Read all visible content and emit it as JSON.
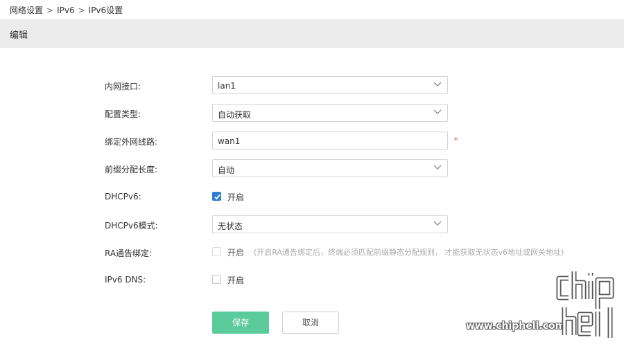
{
  "breadcrumb": {
    "items": [
      "网络设置",
      "IPv6",
      "IPv6设置"
    ],
    "separator": ">"
  },
  "section": {
    "title": "编辑"
  },
  "form": {
    "lan_interface": {
      "label": "内网接口:",
      "value": "lan1"
    },
    "config_type": {
      "label": "配置类型:",
      "value": "自动获取"
    },
    "wan_line": {
      "label": "绑定外网线路:",
      "value": "wan1",
      "required_mark": "*"
    },
    "prefix_length": {
      "label": "前缀分配长度:",
      "value": "自动"
    },
    "dhcpv6": {
      "label": "DHCPv6:",
      "checked": true,
      "option_label": "开启"
    },
    "dhcpv6_mode": {
      "label": "DHCPv6模式:",
      "value": "无状态"
    },
    "ra_binding": {
      "label": "RA通告绑定:",
      "checked": false,
      "option_label": "开启",
      "hint": "(开启RA通告绑定后，终端必须匹配前缀静态分配规则， 才能获取无状态v6地址或网关地址)"
    },
    "ipv6_dns": {
      "label": "IPv6 DNS:",
      "checked": false,
      "option_label": "开启"
    }
  },
  "buttons": {
    "save_label": "保存",
    "cancel_label": "取消"
  },
  "watermark": {
    "url": "www.chiphell.com",
    "logo_text": "chip hell"
  },
  "colors": {
    "header_bg": "#ececec",
    "save_button": "#5ccb9c",
    "checkbox_checked": "#2f7fd8",
    "required": "#e64242"
  }
}
